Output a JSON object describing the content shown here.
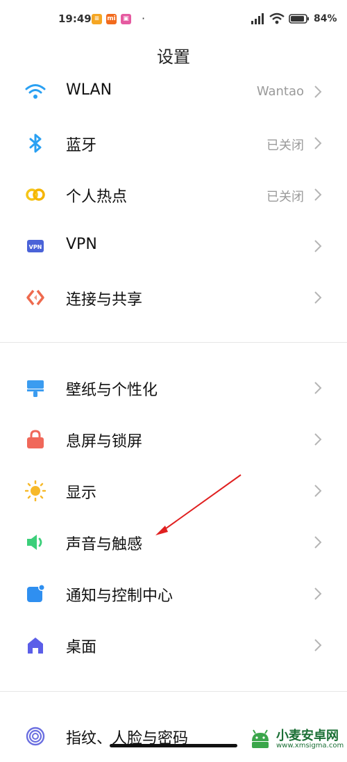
{
  "status_bar": {
    "time": "19:49",
    "notif_mi": "mi",
    "battery_percent": "84%"
  },
  "header": {
    "title": "设置"
  },
  "section1": [
    {
      "label": "WLAN",
      "value": "Wantao",
      "icon": "wifi-icon",
      "color": "#2aa0f2"
    },
    {
      "label": "蓝牙",
      "value": "已关闭",
      "icon": "bluetooth-icon",
      "color": "#2aa0f2"
    },
    {
      "label": "个人热点",
      "value": "已关闭",
      "icon": "hotspot-icon",
      "color": "#f5c518"
    },
    {
      "label": "VPN",
      "value": "",
      "icon": "vpn-icon",
      "color": "#4a63d8"
    },
    {
      "label": "连接与共享",
      "value": "",
      "icon": "connection-share-icon",
      "color": "#ee6a4e"
    }
  ],
  "section2": [
    {
      "label": "壁纸与个性化",
      "icon": "wallpaper-icon",
      "color": "#3b9cf0"
    },
    {
      "label": "息屏与锁屏",
      "icon": "lock-icon",
      "color": "#f0685a"
    },
    {
      "label": "显示",
      "icon": "sun-icon",
      "color": "#f7b92a"
    },
    {
      "label": "声音与触感",
      "icon": "speaker-icon",
      "color": "#3ccf7a"
    },
    {
      "label": "通知与控制中心",
      "icon": "notification-icon",
      "color": "#2f8ff0"
    },
    {
      "label": "桌面",
      "icon": "home-icon",
      "color": "#5b5ee8"
    }
  ],
  "section3": [
    {
      "label": "指纹、人脸与密码",
      "icon": "fingerprint-icon",
      "color": "#6b6fe0"
    }
  ],
  "watermark": {
    "text": "小麦安卓网",
    "url": "www.xmsigma.com"
  }
}
